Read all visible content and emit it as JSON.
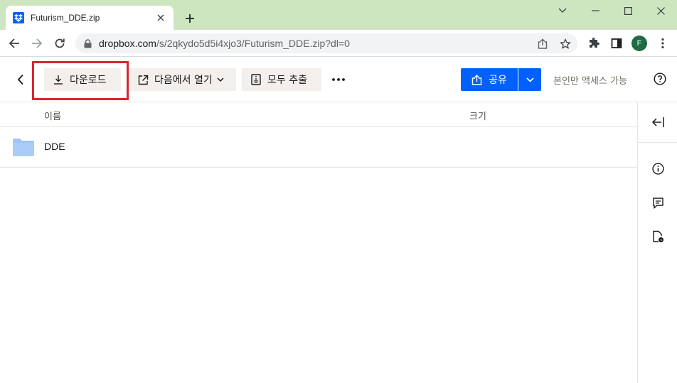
{
  "browser": {
    "tab_title": "Futurism_DDE.zip",
    "url_host": "dropbox.com",
    "url_path": "/s/2qkydo5d5i4xjo3/Futurism_DDE.zip?dl=0",
    "profile_initial": "F"
  },
  "actions": {
    "download": "다운로드",
    "open_in": "다음에서 열기",
    "extract_all": "모두 추출",
    "share": "공유",
    "access": "본인만 액세스 가능"
  },
  "list": {
    "columns": {
      "name": "이름",
      "size": "크기"
    },
    "rows": [
      {
        "name": "DDE",
        "type": "folder",
        "size": ""
      }
    ]
  },
  "colors": {
    "tabstrip": "#cde6c0",
    "primary": "#0061fe",
    "highlight": "#d8262e",
    "button_bg": "#f2efec",
    "folder": "#9fc5f5"
  }
}
